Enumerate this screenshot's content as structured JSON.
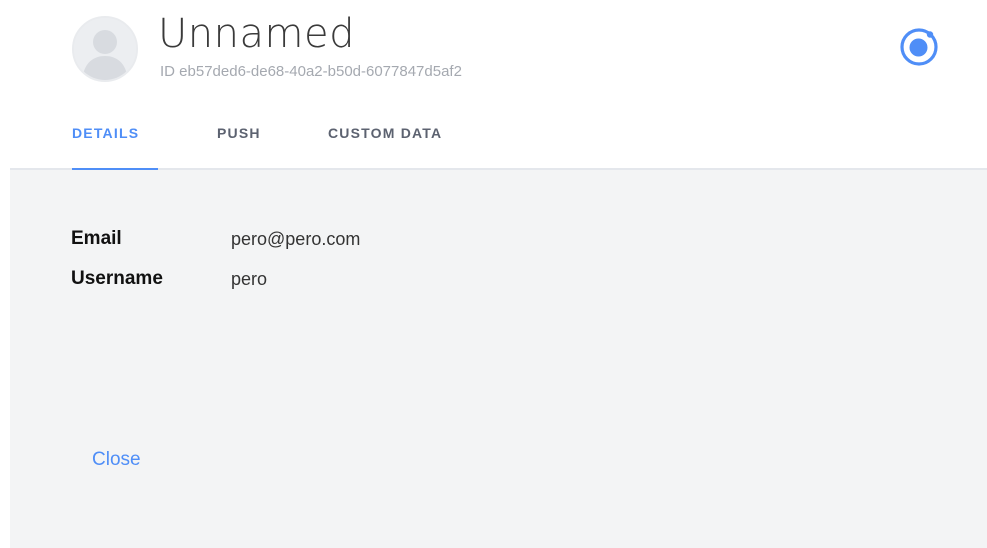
{
  "user": {
    "name": "Unnamed",
    "id_text": "ID eb57ded6-de68-40a2-b50d-6077847d5af2"
  },
  "tabs": [
    {
      "label": "DETAILS",
      "active": true
    },
    {
      "label": "PUSH",
      "active": false
    },
    {
      "label": "CUSTOM DATA",
      "active": false
    }
  ],
  "details": {
    "email": {
      "label": "Email",
      "value": "pero@pero.com"
    },
    "username": {
      "label": "Username",
      "value": "pero"
    }
  },
  "footer": {
    "close_label": "Close"
  },
  "colors": {
    "accent": "#4f8ef7",
    "content_bg": "#f3f4f5"
  },
  "icons": {
    "avatar": "user-avatar-icon",
    "app": "ionic-logo-icon"
  }
}
